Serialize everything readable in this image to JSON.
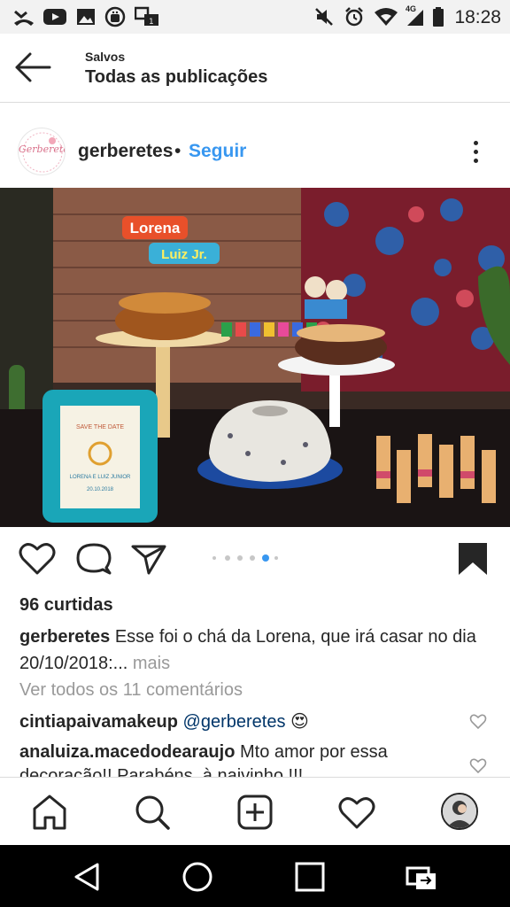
{
  "status_bar": {
    "time": "18:28",
    "network_label": "4G",
    "icons": [
      "missed-call-icon",
      "youtube-icon",
      "gallery-icon",
      "android-debug-icon",
      "transfer-icon",
      "mute-icon",
      "alarm-icon",
      "wifi-icon",
      "signal-icon",
      "battery-icon"
    ]
  },
  "header": {
    "kicker": "Salvos",
    "title": "Todas as publicações"
  },
  "post": {
    "avatar_logo": "Gerberetes",
    "username": "gerberetes",
    "separator": "•",
    "follow_label": "Seguir",
    "photo_topper_bride": "Lorena",
    "photo_topper_groom": "Luiz Jr.",
    "photo_frame_text_1": "SAVE THE DATE",
    "photo_frame_text_2": "LORENA E LUIZ JUNIOR",
    "photo_frame_text_3": "20.10.2018",
    "carousel": {
      "count": 6,
      "active_index": 4
    },
    "likes": "96 curtidas",
    "caption_user": "gerberetes",
    "caption_text": " Esse foi o chá da Lorena, que irá casar no dia 20/10/2018:...",
    "caption_more": " mais",
    "view_comments": "Ver todos os 11 comentários",
    "comments": [
      {
        "user": "cintiapaivamakeup",
        "mention": "@gerberetes",
        "emoji": "😍"
      },
      {
        "user": "analuiza.macedodearaujo",
        "text": " Mto amor por essa",
        "text_cont": "decoração!! Parabéns, à naivinho !!!"
      }
    ]
  },
  "colors": {
    "accent_blue": "#3897f0",
    "text": "#262626",
    "muted": "#999999",
    "divider": "#dbdbdb"
  }
}
